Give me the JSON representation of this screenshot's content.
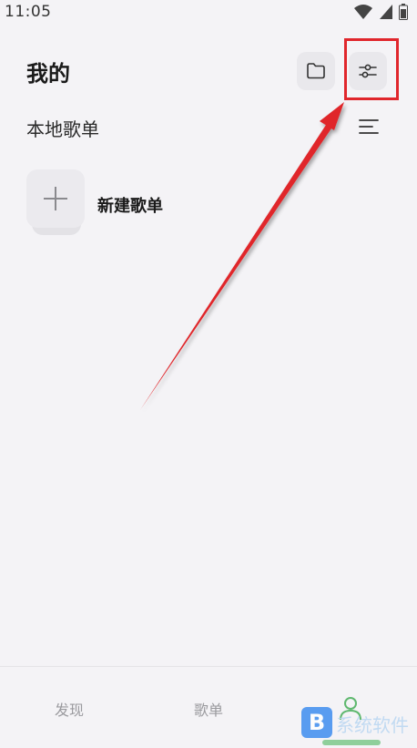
{
  "status_bar": {
    "time": "11:05",
    "icons": [
      "wifi-icon",
      "signal-icon",
      "battery-icon"
    ]
  },
  "header": {
    "title": "我的",
    "folder_icon": "folder-icon",
    "settings_icon": "sliders-icon"
  },
  "local_playlists": {
    "title": "本地歌单",
    "sort_icon": "sort-lines-icon",
    "new_playlist_label": "新建歌单"
  },
  "bottom_nav": {
    "tabs": [
      {
        "label": "发现"
      },
      {
        "label": "歌单"
      },
      {
        "label": "我的"
      }
    ],
    "active": "我的"
  },
  "watermark": {
    "logo": "B",
    "text": "系统软件"
  },
  "colors": {
    "background": "#f4f3f6",
    "annotation_red": "#e0262c",
    "active_green": "#5fb86f"
  }
}
